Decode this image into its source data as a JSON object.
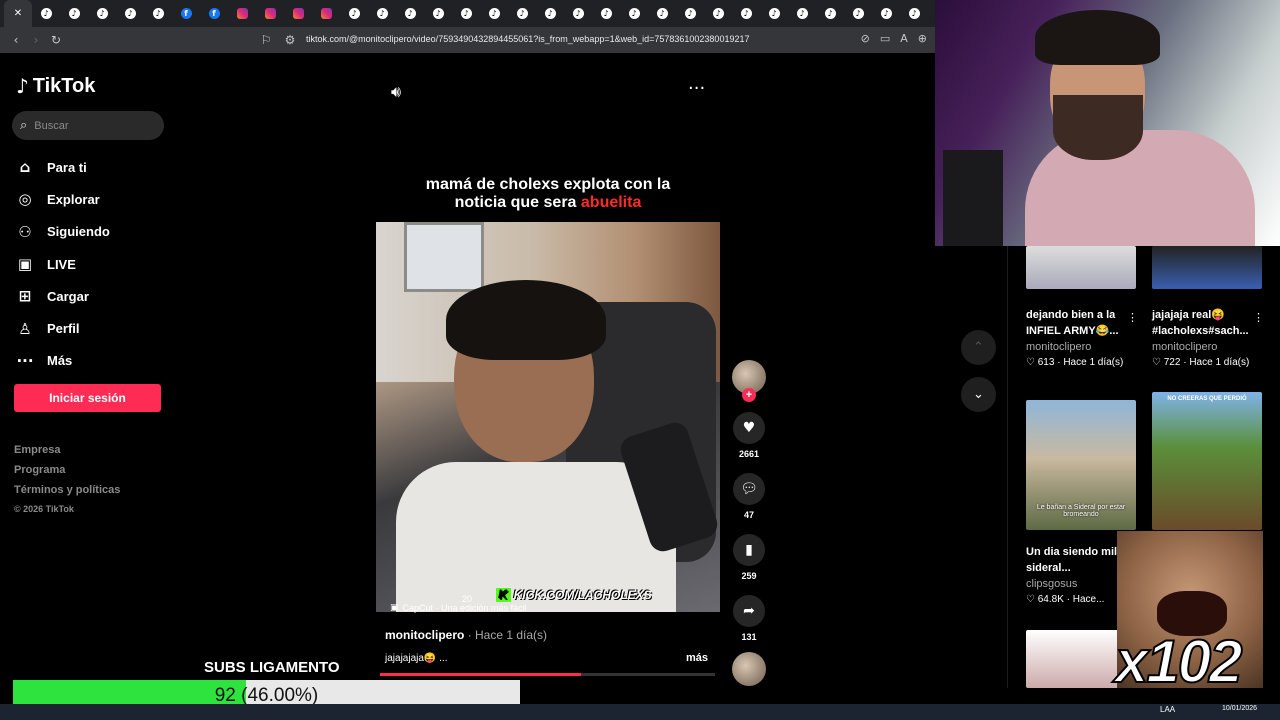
{
  "browser": {
    "tabs": [
      {
        "icon": "close-icon"
      },
      {
        "icon": "tiktok-icon"
      },
      {
        "icon": "tiktok-icon"
      },
      {
        "icon": "tiktok-icon"
      },
      {
        "icon": "tiktok-icon"
      },
      {
        "icon": "tiktok-icon"
      },
      {
        "icon": "facebook-icon"
      },
      {
        "icon": "facebook-icon"
      },
      {
        "icon": "instagram-icon"
      },
      {
        "icon": "instagram-icon"
      },
      {
        "icon": "instagram-icon"
      },
      {
        "icon": "instagram-icon"
      },
      {
        "icon": "tiktok-icon"
      },
      {
        "icon": "tiktok-icon"
      },
      {
        "icon": "tiktok-icon"
      },
      {
        "icon": "tiktok-icon"
      },
      {
        "icon": "tiktok-icon"
      },
      {
        "icon": "tiktok-icon"
      },
      {
        "icon": "tiktok-icon"
      },
      {
        "icon": "tiktok-icon"
      },
      {
        "icon": "tiktok-icon"
      },
      {
        "icon": "tiktok-icon"
      },
      {
        "icon": "tiktok-icon"
      },
      {
        "icon": "tiktok-icon"
      },
      {
        "icon": "tiktok-icon"
      },
      {
        "icon": "tiktok-icon"
      },
      {
        "icon": "tiktok-icon"
      },
      {
        "icon": "tiktok-icon"
      },
      {
        "icon": "tiktok-icon"
      },
      {
        "icon": "tiktok-icon"
      },
      {
        "icon": "tiktok-icon"
      },
      {
        "icon": "tiktok-icon"
      },
      {
        "icon": "tiktok-icon"
      }
    ],
    "url": "tiktok.com/@monitoclipero/video/7593490432894455061?is_from_webapp=1&web_id=7578361002380019217"
  },
  "sidebar": {
    "logo": "TikTok",
    "search_placeholder": "Buscar",
    "nav": [
      {
        "label": "Para ti",
        "icon": "home-icon",
        "glyph": "⌂"
      },
      {
        "label": "Explorar",
        "icon": "compass-icon",
        "glyph": "◎"
      },
      {
        "label": "Siguiendo",
        "icon": "following-icon",
        "glyph": "⚇"
      },
      {
        "label": "LIVE",
        "icon": "live-icon",
        "glyph": "▣"
      },
      {
        "label": "Cargar",
        "icon": "upload-icon",
        "glyph": "⊞"
      },
      {
        "label": "Perfil",
        "icon": "profile-icon",
        "glyph": "♙"
      },
      {
        "label": "Más",
        "icon": "more-icon",
        "glyph": "···"
      }
    ],
    "login_button": "Iniciar sesión",
    "footer": [
      "Empresa",
      "Programa",
      "Términos y políticas"
    ],
    "copyright": "© 2026 TikTok"
  },
  "video": {
    "caption_line1": "mamá de cholexs explota con la",
    "caption_line2_prefix": "noticia que sera ",
    "caption_line2_red": "abuelita",
    "overlay_kick": "KICK.COM/LACHOLEXS",
    "overlay_num": "20",
    "capcut": "CapCut · Una edición más fácil",
    "author": "monitoclipero",
    "time": "· Hace 1 día(s)",
    "description": "jajajajaja😝 ...",
    "more": "más",
    "progress": 0.6,
    "likes": "2661",
    "comments": "47",
    "saves": "259",
    "shares": "131"
  },
  "related": [
    {
      "title": "dejando bien a la INFIEL ARMY😂...",
      "user": "monitoclipero",
      "meta": "♡ 613 · Hace 1 día(s)"
    },
    {
      "title": "jajajaja real😝 #lacholexs#sach...",
      "user": "monitoclipero",
      "meta": "♡ 722 · Hace 1 día(s)"
    },
    {
      "title": "Un dia siendo militar sideral...",
      "user": "clipsgosus",
      "meta": "♡ 64.8K · Hace..."
    }
  ],
  "thumb_texts": {
    "sideral": "Le bañan a Sideral por estar bromeando",
    "minecraft": "NO CREERAS QUE PERDIÓ"
  },
  "stream": {
    "subs_title": "SUBS LIGAMENTO",
    "subs_progress_text": "92 (46.00%)",
    "subs_fraction": 0.46,
    "meme_text": "x102"
  },
  "taskbar": {
    "lang": "LAA",
    "date": "10/01/2026"
  }
}
